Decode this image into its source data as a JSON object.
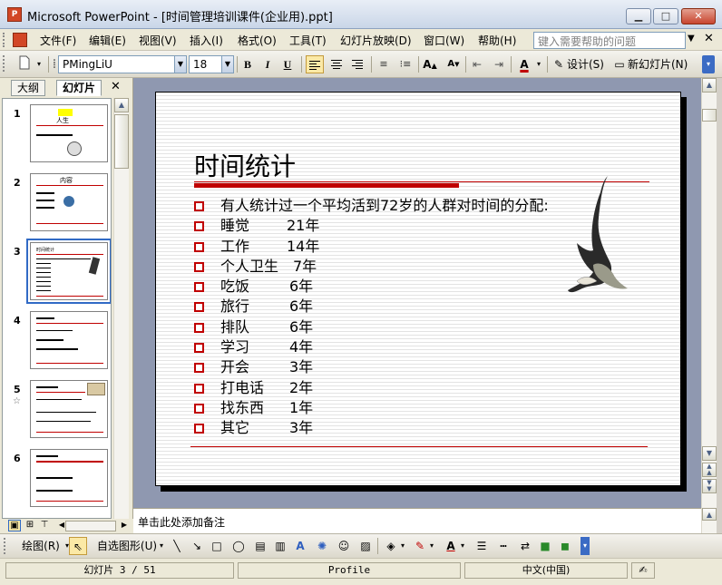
{
  "window": {
    "title": "Microsoft PowerPoint - [时间管理培训课件(企业用).ppt]",
    "app_icon": "P"
  },
  "menu": {
    "items": [
      "文件(F)",
      "编辑(E)",
      "视图(V)",
      "插入(I)",
      "格式(O)",
      "工具(T)",
      "幻灯片放映(D)",
      "窗口(W)",
      "帮助(H)"
    ],
    "ask_placeholder": "键入需要帮助的问题"
  },
  "toolbar": {
    "font_name": "PMingLiU",
    "font_size": "18",
    "bold": "B",
    "italic": "I",
    "underline": "U",
    "design_label": "设计(S)",
    "new_slide_label": "新幻灯片(N)",
    "font_color": "#c00000"
  },
  "panes": {
    "tab_outline": "大纲",
    "tab_slides": "幻灯片"
  },
  "thumbnails": [
    {
      "number": "1",
      "title": "人生"
    },
    {
      "number": "2",
      "title": "内容"
    },
    {
      "number": "3",
      "title": "时间统计"
    },
    {
      "number": "4",
      "title": ""
    },
    {
      "number": "5",
      "title": ""
    },
    {
      "number": "6",
      "title": ""
    }
  ],
  "selected_thumbnail": 3,
  "slide": {
    "title": "时间统计",
    "intro": "有人统计过一个平均活到72岁的人群对时间的分配:",
    "rows": [
      {
        "label": "睡觉",
        "value": "21年"
      },
      {
        "label": "工作",
        "value": "14年"
      },
      {
        "label": "个人卫生",
        "value": "7年"
      },
      {
        "label": "吃饭",
        "value": "6年"
      },
      {
        "label": "旅行",
        "value": "6年"
      },
      {
        "label": "排队",
        "value": "6年"
      },
      {
        "label": "学习",
        "value": "4年"
      },
      {
        "label": "开会",
        "value": "3年"
      },
      {
        "label": "打电话",
        "value": "2年"
      },
      {
        "label": "找东西",
        "value": "1年"
      },
      {
        "label": "其它",
        "value": "3年"
      }
    ],
    "accent_color": "#c00000"
  },
  "notes_placeholder": "单击此处添加备注",
  "drawing": {
    "draw_label": "绘图(R)",
    "autoshape_label": "自选图形(U)"
  },
  "status": {
    "slide_indicator": "幻灯片 3 / 51",
    "design": "Profile",
    "language": "中文(中国)"
  }
}
